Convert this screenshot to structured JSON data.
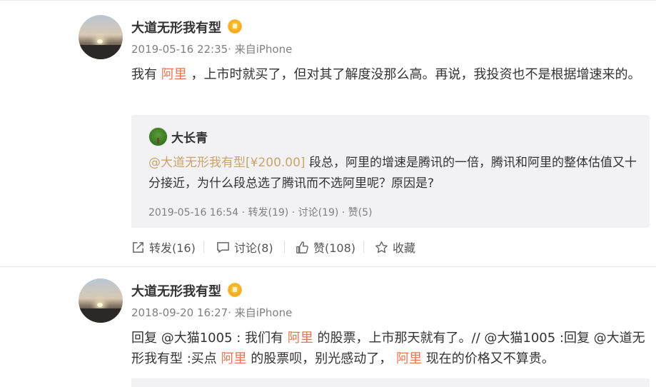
{
  "posts": [
    {
      "author": "大道无形我有型",
      "meta": "2019-05-16 22:35· 来自iPhone",
      "content": {
        "prefix": "我有",
        "link": "阿里",
        "rest": "，上市时就买了，但对其了解度没那么高。再说，我投资也不是根据增速来的。"
      },
      "repost": {
        "author": "大长青",
        "mention": "@大道无形我有型[¥200.00]",
        "text": " 段总，阿里的增速是腾讯的一倍，腾讯和阿里的整体估值又十分接近，为什么段总选了腾讯而不选阿里呢？原因是?",
        "meta": "2019-05-16 16:54 · 转发(19) · 讨论(19) · 赞(5)"
      },
      "actions": {
        "repost": "转发(16)",
        "comment": "讨论(8)",
        "like": "赞(108)",
        "favorite": "收藏"
      }
    },
    {
      "author": "大道无形我有型",
      "meta": "2018-09-20 16:27· 来自iPhone",
      "content": {
        "p1": "回复 @大猫1005 : 我们有",
        "link1": "阿里",
        "p2": "的股票，上市那天就有了。// @大猫1005 :回复 @大道无形我有型 :买点",
        "link2": "阿里",
        "p3": "的股票呗，别光感动了，",
        "link3": "阿里",
        "p4": "现在的价格又不算贵。"
      }
    }
  ],
  "colors": {
    "link": "#eb7350",
    "mention": "#c9a46b",
    "meta": "#808080",
    "repost_bg": "#f2f2f5"
  },
  "icons": [
    "vip-badge-icon",
    "repost-icon",
    "comment-icon",
    "like-icon",
    "star-icon",
    "tree-avatar-icon"
  ]
}
